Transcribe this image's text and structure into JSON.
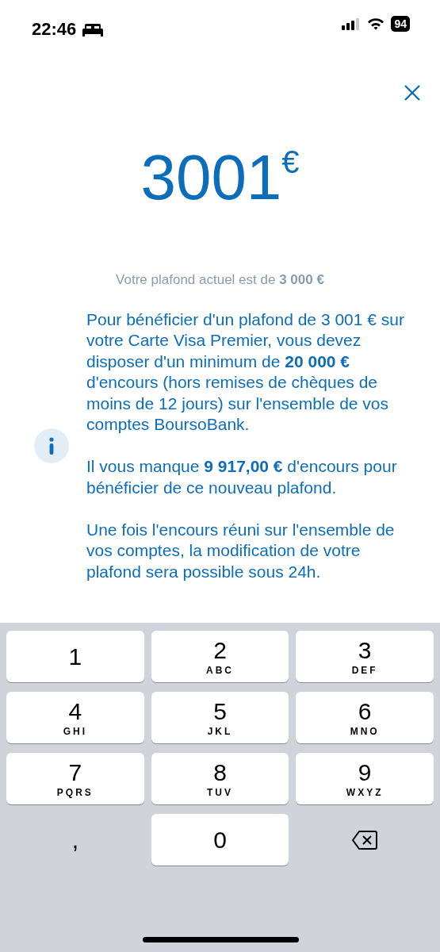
{
  "status_bar": {
    "time": "22:46",
    "battery": "94"
  },
  "amount": {
    "value": "3001",
    "currency": "€"
  },
  "current_limit": "Votre plafond actuel est de **3 000 €**",
  "info_paragraphs": [
    "Pour bénéficier d'un plafond de 3 001 € sur votre Carte Visa Premier, vous devez disposer d'un minimum de **20 000 €** d'encours (hors remises de chèques de moins de 12 jours) sur l'ensemble de vos comptes BoursoBank.",
    "Il vous manque **9 917,00 €** d'encours pour bénéficier de ce nouveau plafond.",
    "Une fois l'encours réuni sur l'ensemble de vos comptes, la modification de votre plafond sera possible sous 24h."
  ],
  "keypad": [
    {
      "kind": "digit",
      "label": "1"
    },
    {
      "kind": "digit",
      "label": "2",
      "letters": "ABC"
    },
    {
      "kind": "digit",
      "label": "3",
      "letters": "DEF"
    },
    {
      "kind": "digit",
      "label": "4",
      "letters": "GHI"
    },
    {
      "kind": "digit",
      "label": "5",
      "letters": "JKL"
    },
    {
      "kind": "digit",
      "label": "6",
      "letters": "MNO"
    },
    {
      "kind": "digit",
      "label": "7",
      "letters": "PQRS"
    },
    {
      "kind": "digit",
      "label": "8",
      "letters": "TUV"
    },
    {
      "kind": "digit",
      "label": "9",
      "letters": "WXYZ"
    },
    {
      "kind": "plain",
      "label": ","
    },
    {
      "kind": "digit",
      "label": "0"
    },
    {
      "kind": "delete"
    }
  ]
}
